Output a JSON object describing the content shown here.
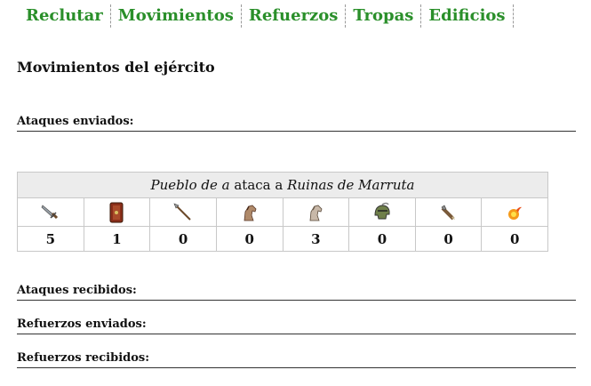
{
  "tabs": [
    "Reclutar",
    "Movimientos",
    "Refuerzos",
    "Tropas",
    "Edificios"
  ],
  "page_title": "Movimientos del ejército",
  "sections": {
    "attacks_sent": "Ataques enviados:",
    "attacks_received": "Ataques recibidos:",
    "reinforcements_sent": "Refuerzos enviados:",
    "reinforcements_received": "Refuerzos recibidos:"
  },
  "movement": {
    "origin": "Pueblo de a",
    "verb": "ataca a",
    "target": "Ruinas de Marruta",
    "units": [
      {
        "icon": "sword-unit-icon",
        "count": "5"
      },
      {
        "icon": "shield-unit-icon",
        "count": "1"
      },
      {
        "icon": "spear-unit-icon",
        "count": "0"
      },
      {
        "icon": "scout-horse-unit-icon",
        "count": "0"
      },
      {
        "icon": "cavalry-horse-unit-icon",
        "count": "3"
      },
      {
        "icon": "helmet-unit-icon",
        "count": "0"
      },
      {
        "icon": "ram-unit-icon",
        "count": "0"
      },
      {
        "icon": "fireball-unit-icon",
        "count": "0"
      }
    ]
  }
}
